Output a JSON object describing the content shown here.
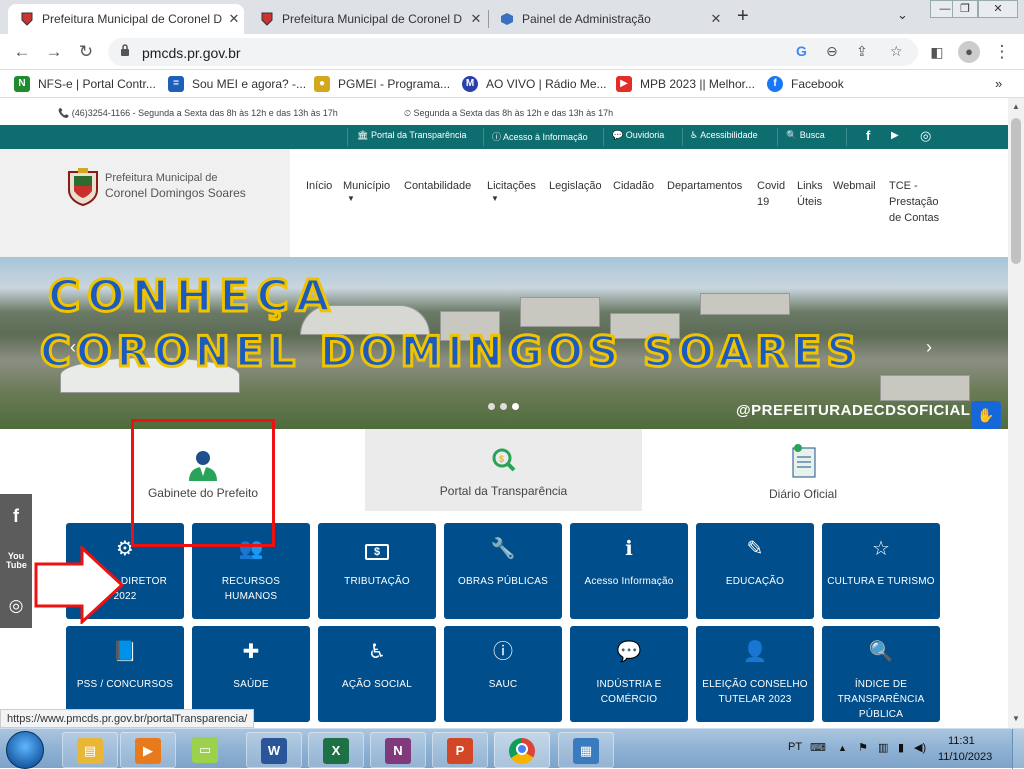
{
  "browser": {
    "tabs": [
      {
        "title": "Prefeitura Municipal de Coronel D",
        "active": true
      },
      {
        "title": "Prefeitura Municipal de Coronel D",
        "active": false
      },
      {
        "title": "Painel de Administração",
        "active": false
      }
    ],
    "new_tab": "+",
    "url": "pmcds.pr.gov.br",
    "bookmarks": [
      {
        "label": "NFS-e | Portal Contr...",
        "icon": "nfse-icon",
        "color": "#1d8b2e"
      },
      {
        "label": "Sou MEI e agora? -...",
        "icon": "mei-icon",
        "color": "#1e5fb8"
      },
      {
        "label": "PGMEI - Programa...",
        "icon": "pgmei-icon",
        "color": "#d4a81e"
      },
      {
        "label": "AO VIVO | Rádio Me...",
        "icon": "radio-icon",
        "color": "#2a3fa8"
      },
      {
        "label": "MPB 2023 || Melhor...",
        "icon": "youtube-icon",
        "color": "#e52d27"
      },
      {
        "label": "Facebook",
        "icon": "facebook-icon",
        "color": "#1877f2"
      }
    ],
    "status_url": "https://www.pmcds.pr.gov.br/portalTransparencia/"
  },
  "site": {
    "top_info": {
      "phone": "(46)3254-1166 - Segunda a Sexta das 8h às 12h e das 13h às 17h",
      "hours": "Segunda a Sexta das 8h às 12h e das 13h às 17h"
    },
    "access_bar": [
      {
        "label": "Portal da Transparência",
        "icon": "bank-icon"
      },
      {
        "label": "Acesso à Informação",
        "icon": "info-icon"
      },
      {
        "label": "Ouvidoria",
        "icon": "chat-icon"
      },
      {
        "label": "Acessibilidade",
        "icon": "wheelchair-icon"
      },
      {
        "label": "Busca",
        "icon": "search-icon"
      }
    ],
    "org_line1": "Prefeitura Municipal de",
    "org_line2": "Coronel Domingos Soares",
    "menu": [
      {
        "label": "Início"
      },
      {
        "label": "Município",
        "dropdown": true
      },
      {
        "label": "Contabilidade"
      },
      {
        "label": "Licitações",
        "dropdown": true
      },
      {
        "label": "Legislação"
      },
      {
        "label": "Cidadão"
      },
      {
        "label": "Departamentos"
      },
      {
        "label": "Covid 19"
      },
      {
        "label": "Links Úteis"
      },
      {
        "label": "Webmail"
      },
      {
        "label": "TCE - Prestação de Contas"
      }
    ],
    "hero": {
      "line1": "CONHEÇA",
      "line2": "CORONEL DOMINGOS SOARES",
      "handle": "@PREFEITURADECDSOFICIAL",
      "slides": 3,
      "active_slide": 3
    },
    "featured": [
      {
        "label": "Gabinete do Prefeito",
        "icon": "mayor-icon"
      },
      {
        "label": "Portal da Transparência",
        "icon": "transparency-search-icon"
      },
      {
        "label": "Diário Oficial",
        "icon": "document-icon"
      }
    ],
    "cards": [
      {
        "label": "PLANO DIRETOR 2022",
        "icon": "gears-icon",
        "glyph": "⚙"
      },
      {
        "label": "RECURSOS HUMANOS",
        "icon": "users-icon",
        "glyph": "👥"
      },
      {
        "label": "TRIBUTAÇÃO",
        "icon": "money-icon",
        "glyph": "$"
      },
      {
        "label": "OBRAS PÚBLICAS",
        "icon": "wrench-icon",
        "glyph": "🔧"
      },
      {
        "label": "Acesso Informação",
        "icon": "info-icon",
        "glyph": "ℹ"
      },
      {
        "label": "EDUCAÇÃO",
        "icon": "pencil-icon",
        "glyph": "✎"
      },
      {
        "label": "CULTURA E TURISMO",
        "icon": "star-icon",
        "glyph": "☆"
      },
      {
        "label": "PSS / CONCURSOS",
        "icon": "book-icon",
        "glyph": "📘"
      },
      {
        "label": "SAÚDE",
        "icon": "ambulance-icon",
        "glyph": "✚"
      },
      {
        "label": "AÇÃO SOCIAL",
        "icon": "wheelchair-icon",
        "glyph": "♿"
      },
      {
        "label": "SAUC",
        "icon": "info-circle-icon",
        "glyph": "ⓘ"
      },
      {
        "label": "INDÚSTRIA E COMÉRCIO",
        "icon": "chat-icon",
        "glyph": "💬"
      },
      {
        "label": "ELEIÇÃO CONSELHO TUTELAR 2023",
        "icon": "user-icon",
        "glyph": "👤"
      },
      {
        "label": "ÍNDICE DE TRANSPARÊNCIA PÚBLICA",
        "icon": "zoom-icon",
        "glyph": "🔍"
      }
    ]
  },
  "taskbar": {
    "apps": [
      {
        "name": "explorer",
        "icon": "folder-icon",
        "color": "#e8b737"
      },
      {
        "name": "media",
        "icon": "media-player-icon",
        "color": "#e87a1e"
      },
      {
        "name": "sticky",
        "icon": "sticky-notes-icon",
        "color": "#9bd14b"
      },
      {
        "name": "word",
        "icon": "word-icon",
        "color": "#2a5699",
        "letter": "W"
      },
      {
        "name": "excel",
        "icon": "excel-icon",
        "color": "#1e7145",
        "letter": "X"
      },
      {
        "name": "onenote",
        "icon": "onenote-icon",
        "color": "#80397b",
        "letter": "N"
      },
      {
        "name": "powerpoint",
        "icon": "powerpoint-icon",
        "color": "#d24726",
        "letter": "P"
      },
      {
        "name": "chrome",
        "icon": "chrome-icon",
        "color": "#4285f4"
      },
      {
        "name": "image",
        "icon": "photo-viewer-icon",
        "color": "#3a7bbd"
      }
    ],
    "lang": "PT",
    "time": "11:31",
    "date": "11/10/2023"
  },
  "accent": "#004f8c",
  "green": "#0e6d6f"
}
